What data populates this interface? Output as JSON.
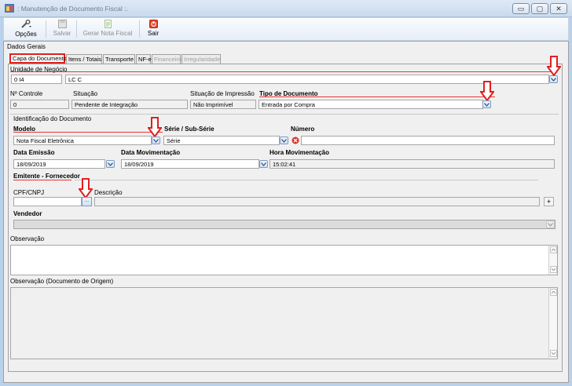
{
  "window": {
    "title": ": Manutenção de Documento Fiscal :.",
    "buttons": {
      "minimize": "▭",
      "restore": "▢",
      "close": "✕"
    }
  },
  "toolbar": {
    "opcoes": "Opções",
    "salvar": "Salvar",
    "gerar_nf": "Gerar Nota Fiscal",
    "sair": "Sair"
  },
  "group_title": "Dados Gerais",
  "tabs": [
    {
      "label": "Capa do Documento",
      "state": "active"
    },
    {
      "label": "Itens / Totais",
      "state": "normal"
    },
    {
      "label": "Transporte",
      "state": "normal"
    },
    {
      "label": "NF-e",
      "state": "normal"
    },
    {
      "label": "Financeiro",
      "state": "disabled"
    },
    {
      "label": "Irregularidade",
      "state": "disabled"
    }
  ],
  "unidade": {
    "label": "Unidade de Negócio",
    "code": "0        I4",
    "name": "LC                                                            C"
  },
  "status_row": {
    "controle_label": "Nº Controle",
    "controle_value": "0",
    "situacao_label": "Situação",
    "situacao_value": "Pendente de Integração",
    "impressao_label": "Situação de Impressão",
    "impressao_value": "Não Imprimível",
    "tipo_label": "Tipo de Documento",
    "tipo_value": "Entrada por Compra"
  },
  "identificacao": {
    "title": "Identificação do Documento",
    "modelo_label": "Modelo",
    "modelo_value": "Nota Fiscal Eletrônica",
    "serie_label": "Série / Sub-Série",
    "serie_value": "Série",
    "numero_label": "Número",
    "numero_value": "",
    "emissao_label": "Data Emissão",
    "emissao_value": "18/09/2019",
    "movimentacao_label": "Data Movimentação",
    "movimentacao_value": "18/09/2019",
    "hora_label": "Hora Movimentação",
    "hora_value": "15:02:41"
  },
  "emitente": {
    "title": "Emitente - Fornecedor",
    "cpf_label": "CPF/CNPJ",
    "cpf_value": "",
    "lookup_button": "...",
    "descricao_label": "Descrição",
    "descricao_value": "",
    "add_button": "+"
  },
  "vendedor": {
    "label": "Vendedor",
    "value": ""
  },
  "observacao": {
    "label": "Observação",
    "value": ""
  },
  "observacao_origem": {
    "label": "Observação (Documento de Origem)",
    "value": ""
  },
  "colors": {
    "highlight_red": "#e02020",
    "window_blue": "#b9d1ea",
    "panel_gray": "#f0f0f0"
  },
  "icons": {
    "app": "app-icon",
    "opcoes": "wrench-icon",
    "salvar": "floppy-disk-icon",
    "gerar_nf": "document-icon",
    "sair": "exit-icon",
    "error": "red-error-icon",
    "annotation": "red-down-arrow-icon"
  }
}
